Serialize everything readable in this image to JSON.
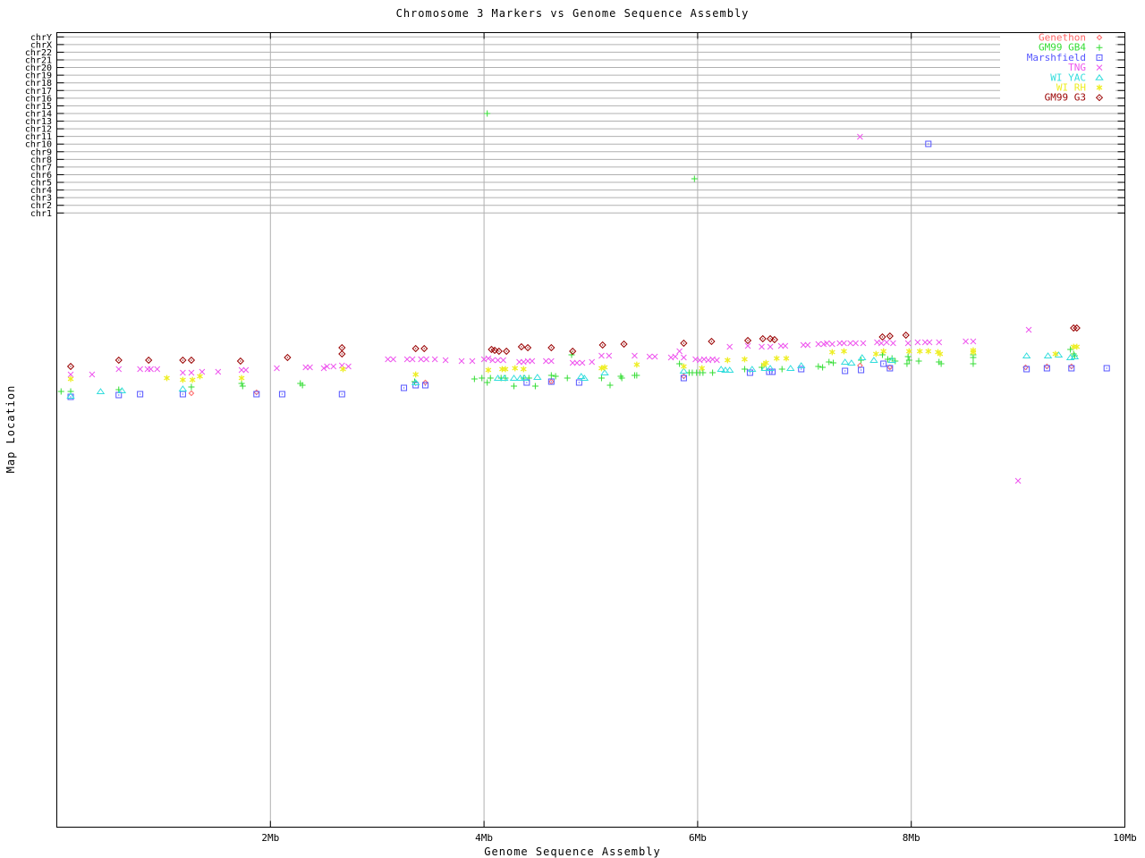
{
  "title": "Chromosome 3 Markers vs Genome Sequence Assembly",
  "colors": {
    "axis": "#000000",
    "grid": "#b0b0b0",
    "background": "#ffffff"
  },
  "chart_data": {
    "type": "scatter",
    "title": "Chromosome 3 Markers vs Genome Sequence Assembly",
    "xlabel": "Genome Sequence Assembly",
    "ylabel": "Map Location",
    "x_unit": "Mb",
    "x_range": [
      0,
      10
    ],
    "x_ticks": [
      {
        "label": "2Mb",
        "mb": 2
      },
      {
        "label": "4Mb",
        "mb": 4
      },
      {
        "label": "6Mb",
        "mb": 6
      },
      {
        "label": "8Mb",
        "mb": 8
      },
      {
        "label": "10Mb",
        "mb": 10
      }
    ],
    "grid_at_mb": [
      2,
      4,
      6,
      8
    ],
    "chromosome_rows": [
      "chrY",
      "chrX",
      "chr22",
      "chr21",
      "chr20",
      "chr19",
      "chr18",
      "chr17",
      "chr16",
      "chr15",
      "chr14",
      "chr13",
      "chr12",
      "chr11",
      "chr10",
      "chr9",
      "chr8",
      "chr7",
      "chr6",
      "chr5",
      "chr4",
      "chr3",
      "chr2",
      "chr1"
    ],
    "y_encoding": "points are [x in Mb, y in screen px rows 36-925]; no numeric y ticks shown; top rows mark chromosome assignment lines",
    "legend_position": "top-right-inside",
    "series": [
      {
        "name": "Genethon",
        "marker": "diamond-small",
        "color": "#ff6666",
        "points": [
          [
            1.26,
            440
          ],
          [
            1.87,
            439
          ],
          [
            3.45,
            428
          ],
          [
            4.63,
            427
          ],
          [
            5.87,
            421
          ],
          [
            7.52,
            409
          ],
          [
            7.8,
            411
          ],
          [
            9.07,
            411
          ],
          [
            9.27,
            410
          ],
          [
            9.5,
            410
          ]
        ]
      },
      {
        "name": "GM99 GB4",
        "marker": "plus",
        "color": "#33dd33",
        "points": [
          [
            0.04,
            438
          ],
          [
            0.13,
            438
          ],
          [
            0.58,
            436
          ],
          [
            1.26,
            433
          ],
          [
            1.73,
            429
          ],
          [
            1.74,
            432
          ],
          [
            2.28,
            429
          ],
          [
            2.3,
            431
          ],
          [
            3.35,
            427
          ],
          [
            3.91,
            424
          ],
          [
            3.98,
            423
          ],
          [
            4.03,
            428
          ],
          [
            4.06,
            423
          ],
          [
            4.16,
            423
          ],
          [
            4.2,
            423
          ],
          [
            4.28,
            432
          ],
          [
            4.37,
            423
          ],
          [
            4.42,
            423
          ],
          [
            4.48,
            432
          ],
          [
            4.63,
            420
          ],
          [
            4.67,
            421
          ],
          [
            4.78,
            423
          ],
          [
            4.82,
            397
          ],
          [
            5.1,
            423
          ],
          [
            5.18,
            431
          ],
          [
            5.28,
            421
          ],
          [
            5.29,
            423
          ],
          [
            5.41,
            420
          ],
          [
            5.43,
            420
          ],
          [
            5.83,
            407
          ],
          [
            5.92,
            417
          ],
          [
            5.95,
            417
          ],
          [
            5.99,
            417
          ],
          [
            6.02,
            417
          ],
          [
            6.05,
            417
          ],
          [
            6.14,
            417
          ],
          [
            6.44,
            413
          ],
          [
            6.6,
            411
          ],
          [
            6.79,
            413
          ],
          [
            7.13,
            410
          ],
          [
            7.17,
            411
          ],
          [
            7.23,
            405
          ],
          [
            7.27,
            406
          ],
          [
            7.53,
            403
          ],
          [
            7.73,
            397
          ],
          [
            7.78,
            402
          ],
          [
            7.82,
            401
          ],
          [
            7.85,
            404
          ],
          [
            7.97,
            399
          ],
          [
            7.98,
            403
          ],
          [
            7.96,
            407
          ],
          [
            8.07,
            404
          ],
          [
            8.26,
            405
          ],
          [
            8.28,
            407
          ],
          [
            8.58,
            397
          ],
          [
            8.58,
            400
          ],
          [
            8.58,
            407
          ],
          [
            9.49,
            391
          ],
          [
            9.52,
            396
          ],
          [
            9.53,
            398
          ],
          [
            4.03,
            127
          ],
          [
            5.97,
            200
          ]
        ]
      },
      {
        "name": "Marshfield",
        "marker": "square-dot",
        "color": "#5555ff",
        "points": [
          [
            0.13,
            444
          ],
          [
            0.58,
            442
          ],
          [
            0.78,
            441
          ],
          [
            1.18,
            441
          ],
          [
            1.87,
            441
          ],
          [
            2.11,
            441
          ],
          [
            2.67,
            441
          ],
          [
            3.25,
            434
          ],
          [
            3.36,
            431
          ],
          [
            3.45,
            431
          ],
          [
            4.4,
            428
          ],
          [
            4.63,
            427
          ],
          [
            4.89,
            428
          ],
          [
            5.87,
            423
          ],
          [
            6.49,
            417
          ],
          [
            6.67,
            416
          ],
          [
            6.7,
            416
          ],
          [
            6.97,
            413
          ],
          [
            7.38,
            415
          ],
          [
            7.53,
            414
          ],
          [
            7.74,
            407
          ],
          [
            7.8,
            412
          ],
          [
            9.08,
            413
          ],
          [
            9.27,
            412
          ],
          [
            9.5,
            412
          ],
          [
            9.83,
            412
          ],
          [
            8.16,
            161
          ]
        ]
      },
      {
        "name": "TNG",
        "marker": "x",
        "color": "#ee55ee",
        "points": [
          [
            0.13,
            419
          ],
          [
            0.33,
            419
          ],
          [
            0.58,
            413
          ],
          [
            0.78,
            413
          ],
          [
            0.85,
            413
          ],
          [
            0.88,
            413
          ],
          [
            0.94,
            413
          ],
          [
            1.18,
            417
          ],
          [
            1.26,
            417
          ],
          [
            1.36,
            416
          ],
          [
            1.51,
            416
          ],
          [
            1.73,
            414
          ],
          [
            1.77,
            414
          ],
          [
            2.06,
            412
          ],
          [
            2.33,
            411
          ],
          [
            2.37,
            411
          ],
          [
            2.5,
            412
          ],
          [
            2.53,
            410
          ],
          [
            2.59,
            410
          ],
          [
            2.67,
            409
          ],
          [
            2.73,
            410
          ],
          [
            3.1,
            402
          ],
          [
            3.15,
            402
          ],
          [
            3.28,
            402
          ],
          [
            3.33,
            402
          ],
          [
            3.41,
            402
          ],
          [
            3.46,
            402
          ],
          [
            3.54,
            402
          ],
          [
            3.64,
            403
          ],
          [
            3.79,
            404
          ],
          [
            3.89,
            404
          ],
          [
            4.0,
            402
          ],
          [
            4.04,
            401
          ],
          [
            4.08,
            403
          ],
          [
            4.13,
            403
          ],
          [
            4.18,
            403
          ],
          [
            4.33,
            405
          ],
          [
            4.37,
            405
          ],
          [
            4.41,
            404
          ],
          [
            4.45,
            404
          ],
          [
            4.58,
            404
          ],
          [
            4.63,
            404
          ],
          [
            4.83,
            406
          ],
          [
            4.87,
            406
          ],
          [
            4.92,
            406
          ],
          [
            5.01,
            405
          ],
          [
            5.1,
            398
          ],
          [
            5.17,
            398
          ],
          [
            5.41,
            398
          ],
          [
            5.55,
            399
          ],
          [
            5.6,
            399
          ],
          [
            5.75,
            400
          ],
          [
            5.79,
            399
          ],
          [
            5.83,
            393
          ],
          [
            5.87,
            400
          ],
          [
            5.98,
            402
          ],
          [
            6.02,
            403
          ],
          [
            6.06,
            402
          ],
          [
            6.1,
            403
          ],
          [
            6.14,
            402
          ],
          [
            6.18,
            403
          ],
          [
            6.3,
            388
          ],
          [
            6.47,
            387
          ],
          [
            6.6,
            388
          ],
          [
            6.68,
            388
          ],
          [
            6.78,
            387
          ],
          [
            6.82,
            387
          ],
          [
            6.99,
            386
          ],
          [
            7.03,
            386
          ],
          [
            7.13,
            385
          ],
          [
            7.18,
            385
          ],
          [
            7.21,
            384
          ],
          [
            7.26,
            385
          ],
          [
            7.33,
            384
          ],
          [
            7.37,
            384
          ],
          [
            7.43,
            384
          ],
          [
            7.48,
            384
          ],
          [
            7.55,
            384
          ],
          [
            7.68,
            383
          ],
          [
            7.72,
            384
          ],
          [
            7.77,
            383
          ],
          [
            7.83,
            384
          ],
          [
            7.97,
            384
          ],
          [
            8.06,
            383
          ],
          [
            8.13,
            383
          ],
          [
            8.17,
            383
          ],
          [
            8.26,
            383
          ],
          [
            8.51,
            382
          ],
          [
            8.58,
            382
          ],
          [
            9.1,
            369
          ],
          [
            7.52,
            153
          ],
          [
            9.0,
            538
          ]
        ]
      },
      {
        "name": "WI YAC",
        "marker": "triangle",
        "color": "#33dddd",
        "points": [
          [
            0.13,
            443
          ],
          [
            0.41,
            438
          ],
          [
            0.61,
            437
          ],
          [
            1.18,
            435
          ],
          [
            3.36,
            428
          ],
          [
            4.13,
            423
          ],
          [
            4.19,
            423
          ],
          [
            4.28,
            423
          ],
          [
            4.34,
            423
          ],
          [
            4.38,
            423
          ],
          [
            4.5,
            422
          ],
          [
            4.91,
            421
          ],
          [
            4.94,
            423
          ],
          [
            5.13,
            417
          ],
          [
            5.87,
            415
          ],
          [
            6.22,
            413
          ],
          [
            6.26,
            414
          ],
          [
            6.3,
            414
          ],
          [
            6.51,
            413
          ],
          [
            6.63,
            412
          ],
          [
            6.68,
            412
          ],
          [
            6.87,
            412
          ],
          [
            6.97,
            409
          ],
          [
            7.38,
            405
          ],
          [
            7.44,
            406
          ],
          [
            7.54,
            400
          ],
          [
            7.65,
            403
          ],
          [
            7.82,
            403
          ],
          [
            9.08,
            398
          ],
          [
            9.28,
            398
          ],
          [
            9.38,
            397
          ],
          [
            9.49,
            400
          ],
          [
            9.53,
            399
          ]
        ]
      },
      {
        "name": "WI RH",
        "marker": "asterisk",
        "color": "#eeee22",
        "points": [
          [
            0.13,
            424
          ],
          [
            1.03,
            423
          ],
          [
            1.18,
            425
          ],
          [
            1.27,
            425
          ],
          [
            1.34,
            421
          ],
          [
            1.73,
            423
          ],
          [
            2.68,
            413
          ],
          [
            3.36,
            419
          ],
          [
            4.04,
            414
          ],
          [
            4.17,
            413
          ],
          [
            4.2,
            413
          ],
          [
            4.29,
            412
          ],
          [
            4.37,
            413
          ],
          [
            5.1,
            412
          ],
          [
            5.13,
            411
          ],
          [
            5.43,
            408
          ],
          [
            5.87,
            410
          ],
          [
            6.04,
            412
          ],
          [
            6.28,
            403
          ],
          [
            6.44,
            402
          ],
          [
            6.62,
            408
          ],
          [
            6.64,
            406
          ],
          [
            6.74,
            401
          ],
          [
            6.83,
            401
          ],
          [
            7.26,
            394
          ],
          [
            7.37,
            393
          ],
          [
            7.67,
            396
          ],
          [
            7.74,
            393
          ],
          [
            7.98,
            393
          ],
          [
            8.08,
            393
          ],
          [
            8.16,
            393
          ],
          [
            8.25,
            394
          ],
          [
            8.27,
            396
          ],
          [
            8.58,
            392
          ],
          [
            8.58,
            394
          ],
          [
            9.35,
            396
          ],
          [
            9.52,
            388
          ],
          [
            9.55,
            388
          ]
        ]
      },
      {
        "name": "GM99 G3",
        "marker": "diamond-dot",
        "color": "#990000",
        "points": [
          [
            0.13,
            410
          ],
          [
            0.58,
            403
          ],
          [
            0.86,
            403
          ],
          [
            1.18,
            403
          ],
          [
            1.26,
            403
          ],
          [
            1.72,
            404
          ],
          [
            2.16,
            400
          ],
          [
            2.67,
            389
          ],
          [
            2.67,
            396
          ],
          [
            3.36,
            390
          ],
          [
            3.44,
            390
          ],
          [
            4.07,
            391
          ],
          [
            4.1,
            392
          ],
          [
            4.14,
            393
          ],
          [
            4.21,
            393
          ],
          [
            4.35,
            388
          ],
          [
            4.41,
            389
          ],
          [
            4.63,
            389
          ],
          [
            4.83,
            393
          ],
          [
            5.11,
            386
          ],
          [
            5.31,
            385
          ],
          [
            5.87,
            384
          ],
          [
            6.13,
            382
          ],
          [
            6.47,
            381
          ],
          [
            6.61,
            379
          ],
          [
            6.68,
            379
          ],
          [
            6.72,
            380
          ],
          [
            7.73,
            377
          ],
          [
            7.8,
            376
          ],
          [
            7.95,
            375
          ],
          [
            9.52,
            367
          ],
          [
            9.55,
            367
          ]
        ]
      }
    ]
  }
}
